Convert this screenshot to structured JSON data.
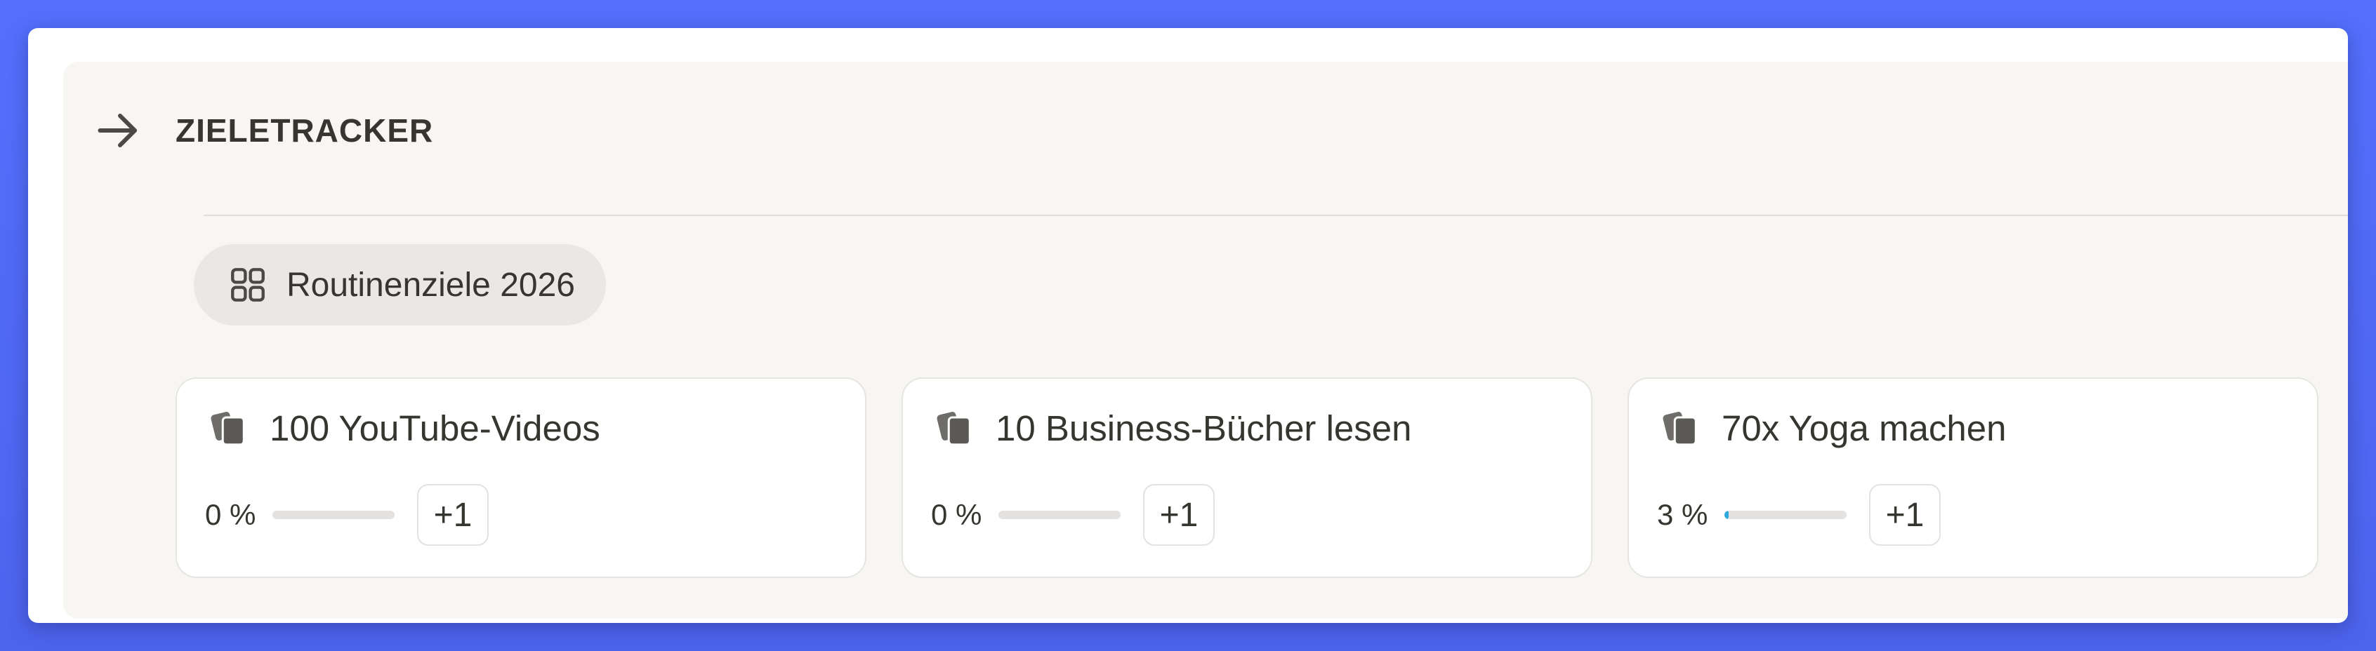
{
  "header": {
    "title": "ZIELETRACKER",
    "icon": "arrow-right-icon"
  },
  "view_chip": {
    "label": "Routinenziele 2026",
    "icon": "gallery-grid-icon"
  },
  "colors": {
    "background": "#5470fd",
    "panel": "#f7f6f3",
    "progress_fill": "#2eaadc"
  },
  "goals": [
    {
      "title": "100 YouTube-Videos",
      "percent_label": "0 %",
      "progress": 0,
      "increment_label": "+1",
      "icon": "cards-icon"
    },
    {
      "title": "10 Business-Bücher lesen",
      "percent_label": "0 %",
      "progress": 0,
      "increment_label": "+1",
      "icon": "cards-icon"
    },
    {
      "title": "70x Yoga machen",
      "percent_label": "3 %",
      "progress": 0.03,
      "increment_label": "+1",
      "icon": "cards-icon"
    }
  ]
}
